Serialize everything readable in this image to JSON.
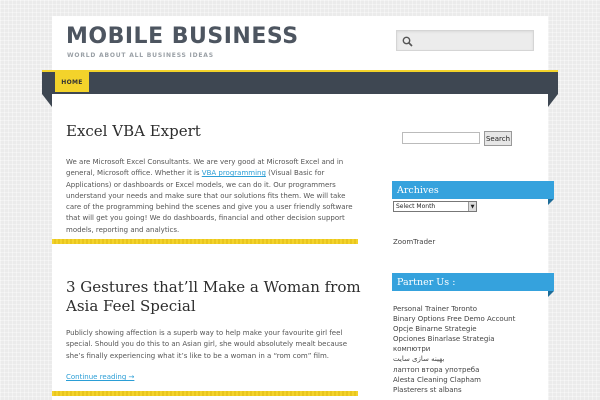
{
  "site": {
    "title": "MOBILE BUSINESS",
    "description": "WORLD ABOUT ALL BUSINESS IDEAS"
  },
  "header_search": {
    "placeholder": "",
    "icon": "magnifier-icon"
  },
  "nav": {
    "items": [
      {
        "label": "HOME"
      }
    ]
  },
  "posts": [
    {
      "title": "Excel VBA Expert",
      "body_before_link": "We are Microsoft Excel Consultants. We are very good at Microsoft Excel and in general, Microsoft office. Whether it is ",
      "link_text": "VBA programming",
      "body_after_link": " (Visual Basic for Applications) or dashboards or Excel models, we can do it. Our programmers understand your needs and make sure that our solutions fits them. We will take care of the programming behind the scenes and give you a user friendly software that will get you going! We do dashboards, financial and other decision support models, reporting and analytics."
    },
    {
      "title": "3 Gestures that’ll Make a Woman from Asia Feel Special",
      "body": "Publicly showing affection is a superb way to help make your favourite girl feel special. Should you do this to an Asian girl, she would absolutely mealt because she’s finally experiencing what it’s like to be a woman in a “rom com” film.",
      "more": "Continue reading →"
    }
  ],
  "sidebar": {
    "search_button": "Search",
    "archives_title": "Archives",
    "archives_select": "Select Month",
    "zoomtrader": "ZoomTrader",
    "partners_title": "Partner Us :",
    "partners": [
      "Personal Trainer Toronto",
      "Binary Options Free Demo Account",
      "Opcje Binarne Strategie",
      "Opciones Binarlase Strategia",
      "компютри",
      "بهینه سازی سایت",
      "лаптоп втора употреба",
      "Alesta Cleaning Clapham",
      "Plasterers st albans"
    ]
  },
  "colors": {
    "accent_yellow": "#f3d32b",
    "nav_dark": "#3e4752",
    "widget_blue": "#35a2dd",
    "link_blue": "#2b9ed6"
  }
}
